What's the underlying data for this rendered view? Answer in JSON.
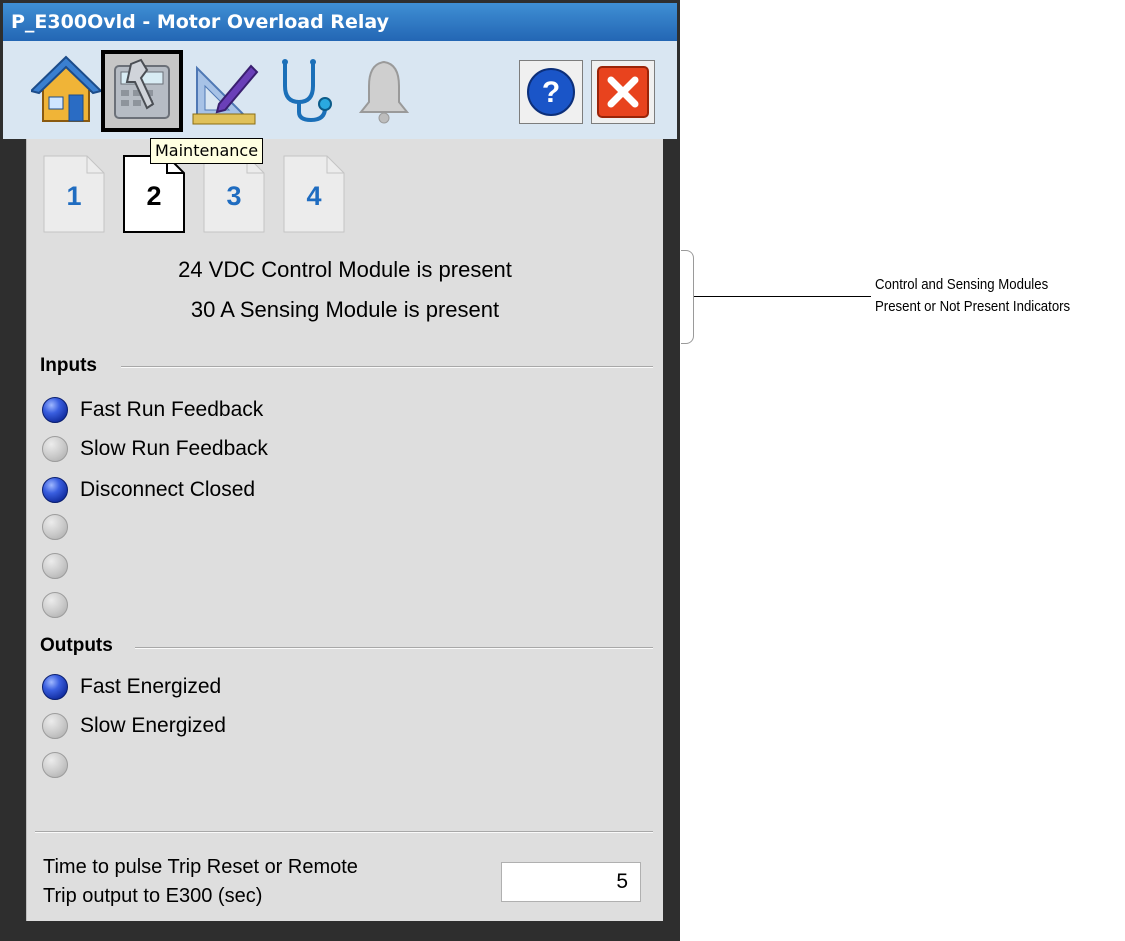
{
  "window": {
    "title": "P_E300Ovld - Motor Overload Relay"
  },
  "toolbar": {
    "buttons": [
      {
        "icon": "home-icon"
      },
      {
        "icon": "maintenance-icon",
        "active": true
      },
      {
        "icon": "engineering-icon"
      },
      {
        "icon": "diagnostics-icon"
      },
      {
        "icon": "alarm-bell-icon"
      }
    ],
    "help_label": "?",
    "close_label": "✕",
    "tooltip": "Maintenance"
  },
  "page_tabs": [
    {
      "label": "1",
      "selected": false
    },
    {
      "label": "2",
      "selected": true
    },
    {
      "label": "3",
      "selected": false
    },
    {
      "label": "4",
      "selected": false
    }
  ],
  "modules": {
    "control": "24 VDC Control Module is present",
    "sensing": "30 A Sensing Module is present"
  },
  "inputs": {
    "heading": "Inputs",
    "items": [
      {
        "label": "Fast Run Feedback",
        "on": true
      },
      {
        "label": "Slow Run Feedback",
        "on": false
      },
      {
        "label": "Disconnect Closed",
        "on": true
      },
      {
        "label": "",
        "on": false
      },
      {
        "label": "",
        "on": false
      },
      {
        "label": "",
        "on": false
      }
    ]
  },
  "outputs": {
    "heading": "Outputs",
    "items": [
      {
        "label": "Fast Energized",
        "on": true
      },
      {
        "label": "Slow Energized",
        "on": false
      },
      {
        "label": "",
        "on": false
      }
    ]
  },
  "pulse": {
    "label_line1": "Time to pulse Trip Reset or Remote",
    "label_line2": "Trip output to E300 (sec)",
    "value": "5"
  },
  "callout": {
    "line1": "Control and Sensing Modules",
    "line2": "Present or Not Present Indicators"
  },
  "colors": {
    "title_bar": "#2e74c2",
    "led_on": "#1f3fc4",
    "led_off": "#c4c4c4",
    "close": "#e8431e",
    "help": "#1a55c8"
  }
}
